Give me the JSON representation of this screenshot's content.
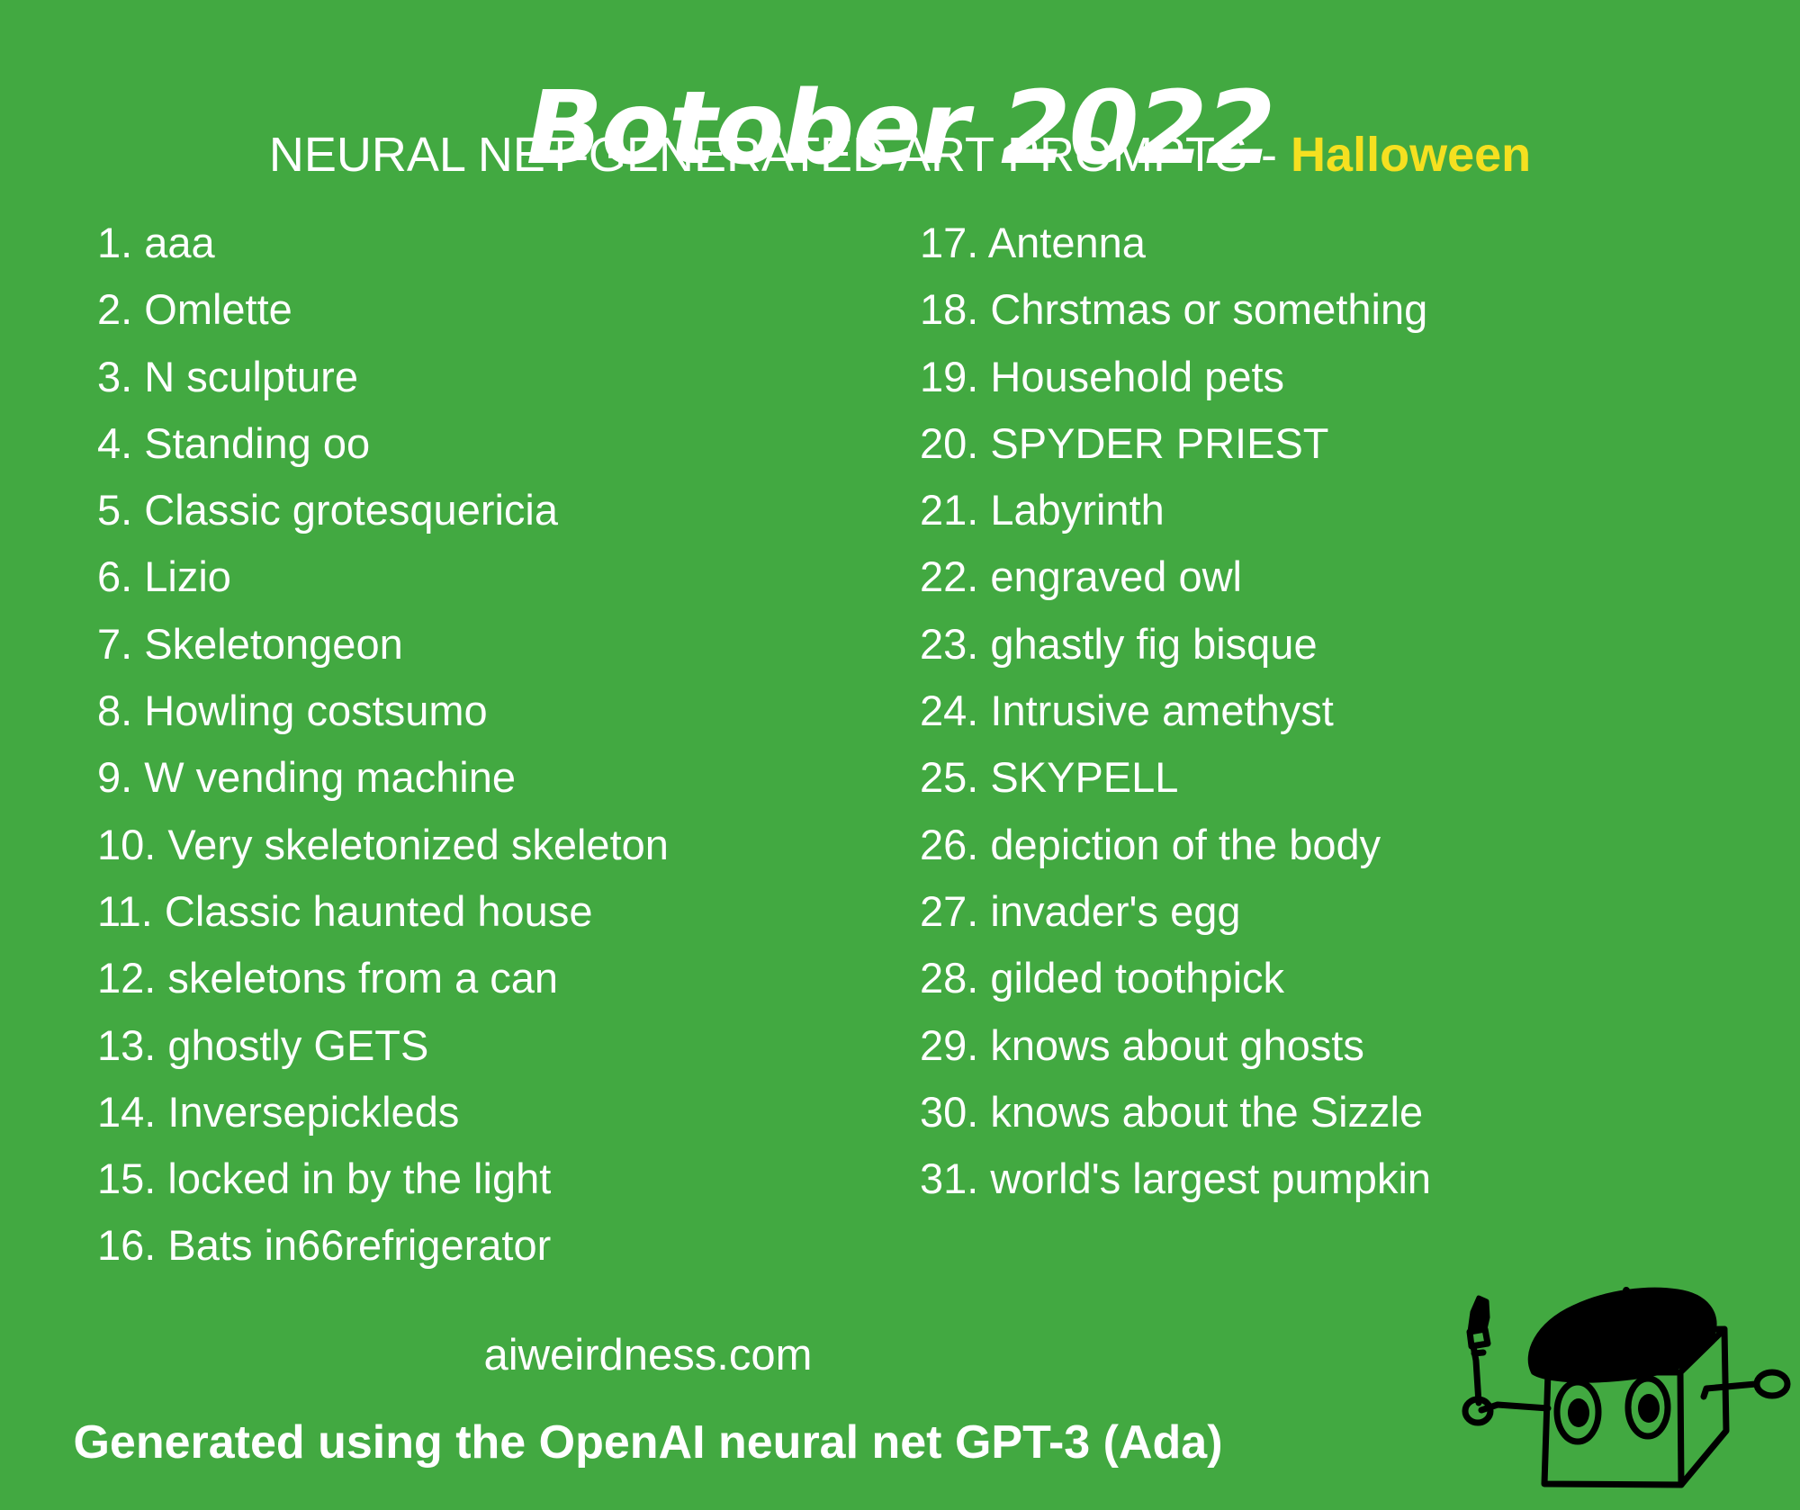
{
  "colors": {
    "background": "#42a941",
    "text": "#ffffff",
    "accent_yellow": "#f5e020",
    "ink": "#000000"
  },
  "header": {
    "title": "Botober 2022",
    "subtitle_prefix": "NEURAL NET-GENERATED ART PROMPTS - ",
    "subtitle_theme": "Halloween"
  },
  "prompts": {
    "left": [
      {
        "num": "1.",
        "text": "aaa"
      },
      {
        "num": "2.",
        "text": "Omlette"
      },
      {
        "num": "3.",
        "text": "N sculpture"
      },
      {
        "num": "4.",
        "text": "Standing oo"
      },
      {
        "num": "5.",
        "text": "Classic grotesquericia"
      },
      {
        "num": "6.",
        "text": "Lizio"
      },
      {
        "num": "7.",
        "text": "Skeletongeon"
      },
      {
        "num": "8.",
        "text": "Howling costsumo"
      },
      {
        "num": "9.",
        "text": "W vending machine"
      },
      {
        "num": "10.",
        "text": "Very skeletonized skeleton"
      },
      {
        "num": "11.",
        "text": "Classic haunted house"
      },
      {
        "num": "12.",
        "text": "skeletons from a can"
      },
      {
        "num": "13.",
        "text": "ghostly GETS"
      },
      {
        "num": "14.",
        "text": "Inversepickleds"
      },
      {
        "num": "15.",
        "text": "locked in by the light"
      },
      {
        "num": "16.",
        "text": "Bats in66refrigerator"
      }
    ],
    "right": [
      {
        "num": "17.",
        "text": "Antenna"
      },
      {
        "num": "18.",
        "text": "Chrstmas or something"
      },
      {
        "num": "19.",
        "text": "Household pets"
      },
      {
        "num": "20.",
        "text": "SPYDER PRIEST"
      },
      {
        "num": "21.",
        "text": "Labyrinth"
      },
      {
        "num": "22.",
        "text": "engraved owl"
      },
      {
        "num": "23.",
        "text": "ghastly fig bisque"
      },
      {
        "num": "24.",
        "text": "Intrusive amethyst"
      },
      {
        "num": "25.",
        "text": "SKYPELL"
      },
      {
        "num": "26.",
        "text": "depiction of the body"
      },
      {
        "num": "27.",
        "text": "invader's egg"
      },
      {
        "num": "28.",
        "text": "gilded toothpick"
      },
      {
        "num": "29.",
        "text": "knows about ghosts"
      },
      {
        "num": "30.",
        "text": "knows about the Sizzle"
      },
      {
        "num": "31.",
        "text": "world's largest pumpkin"
      }
    ]
  },
  "footer": {
    "site_url": "aiweirdness.com",
    "generated_by": "Generated using the OpenAI neural net GPT-3 (Ada)"
  },
  "mascot": {
    "name": "cube-robot-with-beret-and-paintbrush"
  }
}
